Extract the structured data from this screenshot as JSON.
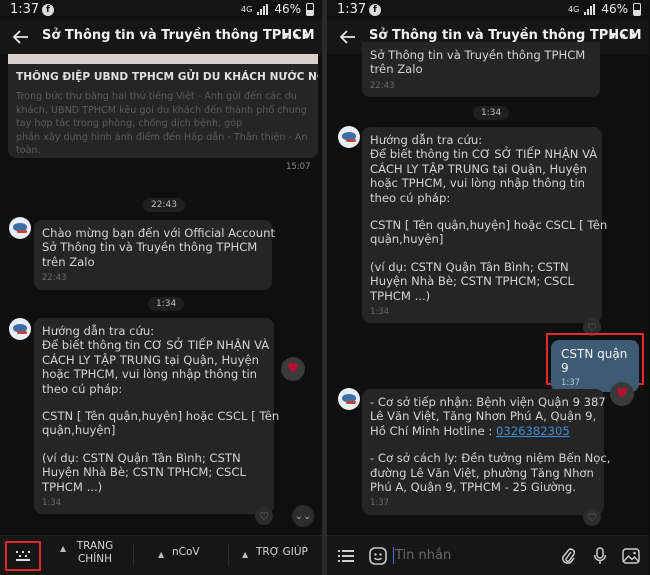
{
  "status_bar": {
    "time": "1:37",
    "network": "4G",
    "battery": "46%"
  },
  "header": {
    "title": "Sở Thông tin và Truyền thông TPHCM"
  },
  "left": {
    "card": {
      "heading": "THÔNG ĐIỆP UBND TPHCM GỬI DU KHÁCH NƯỚC NGOÀI",
      "desc": [
        "Trong bức thư bằng hai thứ tiếng Việt - Anh gửi đến các du",
        "khách, UBND TPHCM kêu gọi du khách đến thành phố chung",
        "tay hợp tác trong phòng, chống dịch bệnh, góp",
        "phần xây dựng hình ảnh điểm đến Hấp dẫn - Thân thiện - An",
        "toàn."
      ],
      "time": "15:07"
    },
    "pill_1": "22:43",
    "welcome": {
      "lines": [
        "Chào mừng bạn đến với Official Account",
        "Sở Thông tin và Truyền thông TPHCM",
        "trên Zalo"
      ],
      "time": "22:43"
    },
    "pill_2": "1:34",
    "guide": {
      "p1": [
        "Hướng dẫn tra cứu:",
        "Để biết thông tin CƠ SỞ TIẾP NHẬN VÀ",
        "CÁCH LY TẬP TRUNG tại Quận, Huyện",
        "hoặc TPHCM, vui lòng nhập thông tin",
        "theo cú pháp:"
      ],
      "p2": [
        "CSTN [ Tên quận,huyện] hoặc CSCL [ Tên",
        "quận,huyện]"
      ],
      "p3": [
        "(ví dụ: CSTN Quận Tân Bình; CSTN",
        "Huyện Nhà Bè; CSTN TPHCM; CSCL",
        "TPHCM ...)"
      ],
      "time": "1:34"
    },
    "menu": {
      "item1_line1": "TRANG",
      "item1_line2": "CHÍNH",
      "item2": "nCoV",
      "item3": "TRỢ GIÚP"
    }
  },
  "right": {
    "welcome_partial": {
      "lines": [
        "Sở Thông tin và Truyền thông TPHCM",
        "trên Zalo"
      ],
      "time": "22:43"
    },
    "pill": "1:34",
    "guide": {
      "p1": [
        "Hướng dẫn tra cứu:",
        "Để biết thông tin CƠ SỞ TIẾP NHẬN VÀ",
        "CÁCH LY TẬP TRUNG tại Quận, Huyện",
        "hoặc TPHCM, vui lòng nhập thông tin",
        "theo cú pháp:"
      ],
      "p2": [
        "CSTN [ Tên quận,huyện] hoặc CSCL [ Tên",
        "quận,huyện]"
      ],
      "p3": [
        "(ví dụ: CSTN Quận Tân Bình; CSTN",
        "Huyện Nhà Bè; CSTN TPHCM; CSCL",
        "TPHCM ...)"
      ],
      "time": "1:34"
    },
    "my_message": {
      "text": "CSTN quận 9",
      "time": "1:37"
    },
    "reply": {
      "p1": [
        "- Cơ sở tiếp nhận: Bệnh viện Quận 9 387",
        "Lê Văn Việt, Tăng Nhơn Phú A, Quận 9,"
      ],
      "p1_last_prefix": "Hồ Chí Minh Hotline : ",
      "phone": "0326382305",
      "p2": [
        "- Cơ sở cách ly: Đền tưởng niệm Bến Nọc,",
        "đường Lê Văn Việt, phường Tăng Nhơn",
        "Phú A, Quận 9, TPHCM - 25 Giường."
      ],
      "time": "1:37"
    },
    "compose_placeholder": "Tin nhắn"
  }
}
